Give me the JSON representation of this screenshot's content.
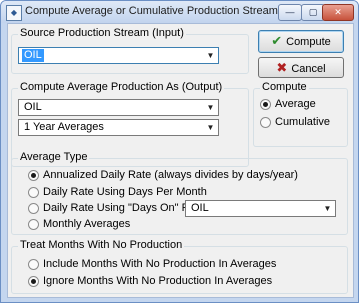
{
  "window": {
    "title": "Compute Average or Cumulative Production Stream",
    "icons": {
      "app": "app-window-icon",
      "minimize": "minimize-icon",
      "maximize": "maximize-icon",
      "close": "close-icon"
    },
    "caption_glyphs": {
      "minimize": "—",
      "maximize": "▢",
      "close": "✕"
    }
  },
  "source_group": {
    "title": "Source Production Stream (Input)",
    "value": "OIL"
  },
  "output_group": {
    "title": "Compute Average Production As (Output)",
    "stream_value": "OIL",
    "interval_value": "1 Year Averages"
  },
  "compute_group": {
    "title": "Compute",
    "options": [
      {
        "label": "Average",
        "selected": true
      },
      {
        "label": "Cumulative",
        "selected": false
      }
    ]
  },
  "average_type": {
    "title": "Average Type",
    "options": [
      {
        "label": "Annualized Daily Rate (always divides by days/year)",
        "selected": true
      },
      {
        "label": "Daily Rate Using Days Per Month",
        "selected": false
      },
      {
        "label": "Daily Rate Using \"Days On\" From",
        "selected": false
      },
      {
        "label": "Monthly Averages",
        "selected": false
      }
    ],
    "days_on_source": "OIL"
  },
  "zero_months": {
    "title": "Treat Months With No Production",
    "options": [
      {
        "label": "Include Months With No Production In Averages",
        "selected": false
      },
      {
        "label": "Ignore Months With No Production In Averages",
        "selected": true
      }
    ]
  },
  "buttons": {
    "compute": {
      "label": "Compute",
      "icon": "checkmark-icon",
      "glyph": "✔",
      "color": "#2e8b2e"
    },
    "cancel": {
      "label": "Cancel",
      "icon": "x-cancel-icon",
      "glyph": "✖",
      "color": "#b02020"
    }
  },
  "dropdown_glyph": "▼"
}
